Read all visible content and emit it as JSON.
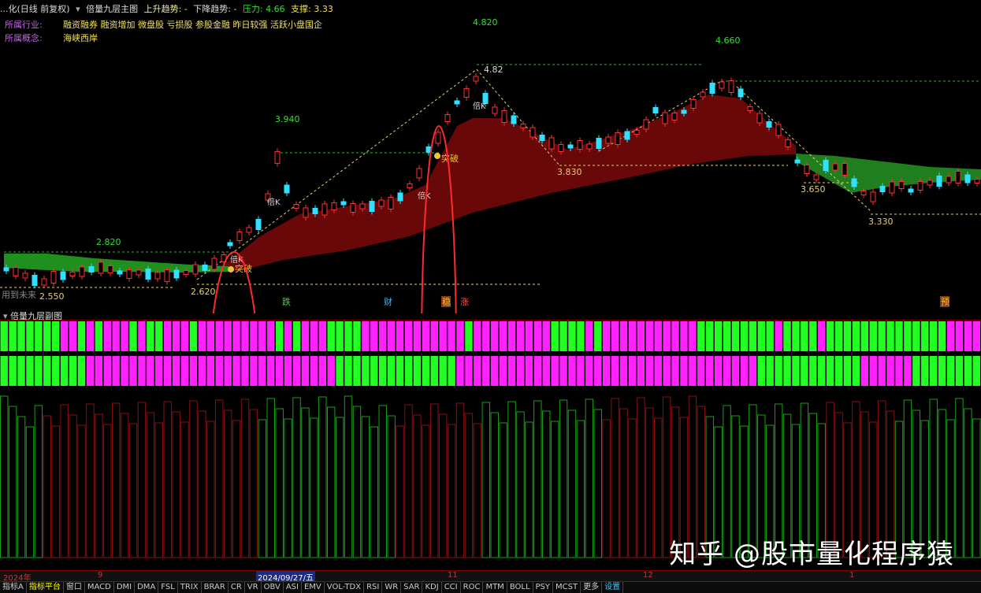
{
  "header": {
    "prefix": "...化(日线 前复权)",
    "indicator_name": "倍量九层主图",
    "up_trend": "上升趋势: -",
    "down_trend": "下降趋势: -",
    "pressure": "压力: 4.66",
    "support": "支撑: 3.33"
  },
  "info": {
    "industry_label": "所属行业:",
    "industry_value": "融资融券 融资增加 微盘股 亏损股 参股金融 昨日较强 活跃小盘国企",
    "concept_label": "所属概念:",
    "concept_value": "海峡西岸"
  },
  "price_labels": [
    "4.820",
    "4.660",
    "3.940",
    "2.820",
    "2.620",
    "2.550",
    "3.830",
    "3.650",
    "3.330",
    "4.82"
  ],
  "markers": {
    "break1": "突破",
    "break2": "突破",
    "bei1": "倍K",
    "bei2": "倍K",
    "bei3": "倍K",
    "bei4": "倍K",
    "future": "用到未来"
  },
  "signals": [
    "跌",
    "财",
    "稳",
    "涨",
    "预"
  ],
  "sub_title": "倍量九层副图",
  "dates": [
    "2024年",
    "9",
    "2024/09/27/五",
    "11",
    "12",
    "1"
  ],
  "tabs": [
    "指标A",
    "指标平台",
    "窗口",
    "MACD",
    "DMI",
    "DMA",
    "FSL",
    "TRIX",
    "BRAR",
    "CR",
    "VR",
    "OBV",
    "ASI",
    "EMV",
    "VOL-TDX",
    "RSI",
    "WR",
    "SAR",
    "KDJ",
    "CCI",
    "ROC",
    "MTM",
    "BOLL",
    "PSY",
    "MCST",
    "更多",
    "设置"
  ],
  "watermark": "知乎 @股市量化程序猿",
  "colors": {
    "up": "#ff3030",
    "down": "#30e0ff",
    "green_bar": "#22ff22",
    "magenta_bar": "#ff22ff",
    "cloud_red": "#7a0a0a",
    "cloud_green": "#1f8f1f"
  }
}
